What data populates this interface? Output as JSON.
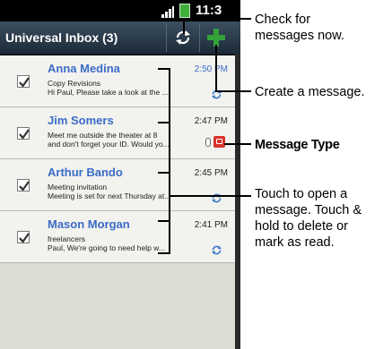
{
  "statusbar": {
    "time": "11:3"
  },
  "app": {
    "title": "Universal Inbox (3)"
  },
  "messages": [
    {
      "sender": "Anna Medina",
      "time": "2:50 PM",
      "subject": "Copy Revisions",
      "preview": "Hi Paul, Please take a look at the ..."
    },
    {
      "sender": "Jim Somers",
      "time": "2:47 PM",
      "subject": "Meet me outside the theater at 8",
      "preview": "and don't forget your ID. Would yo..."
    },
    {
      "sender": "Arthur Bando",
      "time": "2:45 PM",
      "subject": "Meeting invitation",
      "preview": "Meeting is set for next Thursday at..."
    },
    {
      "sender": "Mason Morgan",
      "time": "2:41 PM",
      "subject": "freelancers",
      "preview": "Paul, We're going to need help w..."
    }
  ],
  "annotations": {
    "check": [
      "Check for",
      "messages now."
    ],
    "create": "Create a message.",
    "msgtype": "Message Type",
    "touch": [
      "Touch to open a",
      "message. Touch &",
      "hold to delete or",
      "mark as read."
    ]
  },
  "colors": {
    "sender": "#3a6cc8",
    "titlebar": "#2b3b4a",
    "compose": "#33a23a",
    "msgtype_badge": "#d8342b"
  },
  "icons": {
    "refresh": "refresh-icon",
    "compose": "plus-icon",
    "checkbox": "check-icon",
    "service": "sync-icon",
    "message_type": "email-icon"
  }
}
